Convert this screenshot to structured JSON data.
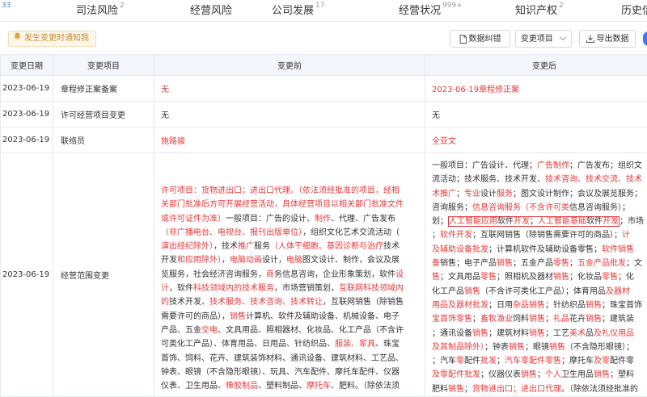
{
  "tabs": [
    {
      "label": "",
      "count": "33"
    },
    {
      "label": "司法风险",
      "count": "2"
    },
    {
      "label": "经营风险",
      "count": ""
    },
    {
      "label": "公司发展",
      "count": "17"
    },
    {
      "label": "经营状况",
      "count": "999+"
    },
    {
      "label": "知识产权",
      "count": "2"
    },
    {
      "label": "历史信",
      "count": ""
    }
  ],
  "toolbar": {
    "notice": "发生变更时通知我",
    "fix_label": "数据纠错",
    "type_label": "变更项目",
    "export_label": "导出数据"
  },
  "table": {
    "headers": [
      "变更日期",
      "变更项目",
      "变更前",
      "变更后"
    ],
    "rows": [
      {
        "date": "2023-06-19",
        "item": "章程修正案备案",
        "before": "无",
        "after": "2023-06-19章程修正案"
      },
      {
        "date": "2023-06-19",
        "item": "许可经营项目变更",
        "before": "无",
        "after": "无"
      },
      {
        "date": "2023-06-19",
        "item": "联络员",
        "before": "施路骏",
        "after": "全亚文"
      },
      {
        "date": "2023-06-19",
        "item": "经营范围变更",
        "before": "",
        "after": ""
      }
    ]
  },
  "scope_before_lines": [
    "许可项目：货物进出口；进出口代理。（依法须经批准的项目，经相",
    "关部门批准后方可开展经营活动，具体经营项目以相关部门批准文件",
    "或许可证件为准）一般项目：广告的设计、制作、代理、广告发布",
    "（非广播电台、电视台、报刊出版单位），组织文化艺术交流活动（",
    "演出经纪除外），技术推广服务（人体干细胞、基因诊断与治疗技术",
    "开发和应用除外），电脑动画设计，电脑图文设计、制作，会议及展",
    "览服务，社会经济咨询服务，商务信息咨询，企业形象策划，软件设",
    "计，软件科技领域内的技术服务，市场营销策划，互联网科技领域内",
    "的技术开发、技术服务、技术咨询、技术转让，互联网销售（除销售",
    "需要许可的商品），销售计算机、软件及辅助设备、机械设备、电子",
    "产品、五金交电、文具用品、照相器材、化妆品、化工产品（不含许",
    "可类化工产品）、体育用品、日用品、针纺织品、服装、家具、珠宝",
    "首饰、饲料、花卉、建筑装饰材料、通讯设备、建筑材料、工艺品、",
    "钟表、眼镜（不含隐形眼镜）、玩具、汽车配件、摩托车配件、仪器",
    "仪表、卫生用品、橡胶制品、塑料制品、摩托车、肥料。（除依法须"
  ],
  "scope_after_lines": [
    "一般项目：广告设计、代理；广告制作；广告发布；组织文",
    "流活动；技术服务、技术开发、技术咨询、技术交流、技术",
    "术推广；专业设计服务；图文设计制作；会议及展览服务；",
    "咨询服务；信息咨询服务（不含许可类信息咨询服务）；",
    "划；人工智能应用软件开发；人工智能基础软件开发；市场",
    "；软件开发；互联网销售（除销售需要许可的商品）；计",
    "及辅助设备批发；计算机软件及辅助设备零售；软件销售",
    "备销售；电子产品销售；五金产品零售；五金产品批发；文",
    "售；文具用品零售；照相机及器材销售；化妆品零售；化",
    "化工产品销售（不含许可类化工产品）；体育用品及器材",
    "用品及器材批发；日用杂品销售；针纺织品销售；珠宝首饰",
    "宝首饰零售；畜牧渔业饲料销售；礼品花卉销售；建筑装",
    "；通讯设备销售；建筑材料销售；工艺美术品及礼仪用品",
    "及其制品除外）；钟表销售；眼镜销售（不含隐形眼镜）；",
    "；汽车零配件批发；汽车零配件零售；摩托车及零配件零",
    "及零配件批发；仪器仪表销售；个人卫生用品销售；塑料",
    "肥料销售；货物进出口；进出口代理。（除依法须经批准的"
  ]
}
